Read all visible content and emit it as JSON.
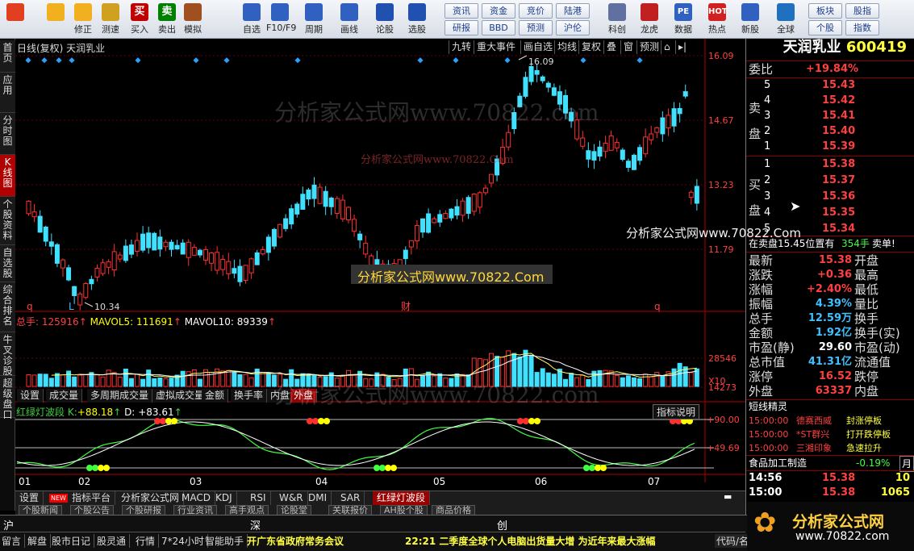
{
  "toolbar": {
    "buttons": [
      {
        "label": "",
        "icon": "windows-logo-icon",
        "color": "#e04020"
      },
      {
        "label": "",
        "icon": "back-arrow-icon",
        "color": "#f0b020"
      },
      {
        "label": "修正",
        "icon": "up-arrow-icon",
        "color": "#f0b020"
      },
      {
        "label": "测速",
        "icon": "clock-icon",
        "color": "#d0a020"
      },
      {
        "label": "买入",
        "icon": "buy-icon",
        "color": "#c00000",
        "glyph": "买"
      },
      {
        "label": "卖出",
        "icon": "sell-icon",
        "color": "#008000",
        "glyph": "卖"
      },
      {
        "label": "模拟",
        "icon": "hammer-icon",
        "color": "#a05020"
      },
      {
        "label": "自选",
        "icon": "star-icon",
        "color": "#3060c0"
      },
      {
        "label": "F10/F9",
        "icon": "f10-icon",
        "color": "#3060c0"
      },
      {
        "label": "周期",
        "icon": "period-icon",
        "color": "#3060c0"
      },
      {
        "label": "画线",
        "icon": "pencil-icon",
        "color": "#3060c0"
      },
      {
        "label": "论股",
        "icon": "forum-icon",
        "color": "#2050b0"
      },
      {
        "label": "选股",
        "icon": "select-stock-icon",
        "color": "#2050b0"
      }
    ],
    "small_buttons": [
      "资讯",
      "资金",
      "竞价",
      "陆港",
      "研报",
      "BBD",
      "预测",
      "沪伦"
    ],
    "right_buttons": [
      {
        "label": "科创",
        "icon": "chart-icon",
        "color": "#6070a0"
      },
      {
        "label": "龙虎",
        "icon": "dragon-tiger-icon",
        "color": "#c02020"
      },
      {
        "label": "数据",
        "icon": "pe-data-icon",
        "color": "#3060c0",
        "glyph": "PE"
      },
      {
        "label": "热点",
        "icon": "hot-icon",
        "color": "#d02020",
        "glyph": "HOT"
      },
      {
        "label": "新股",
        "icon": "new-stock-icon",
        "color": "#3060c0"
      },
      {
        "label": "全球",
        "icon": "globe-icon",
        "color": "#2070c0"
      }
    ],
    "far_right": [
      "板块",
      "股指",
      "个股",
      "指数"
    ]
  },
  "left_nav": [
    "首页",
    "应用",
    "分时图",
    "K线图",
    "个股资料",
    "自选股",
    "综合排名",
    "牛叉诊股",
    "超级盘口"
  ],
  "chart": {
    "header": "日线(复权) 天润乳业",
    "menu": [
      "九转",
      "重大事件",
      "画自选",
      "均线",
      "复权",
      "叠",
      "窗",
      "预测"
    ],
    "price_axis": [
      "16.09",
      "14.67",
      "13.23",
      "11.79"
    ],
    "high_label": "16.09",
    "low_label": "10.34",
    "markers": [
      "q",
      "L",
      "财",
      "q"
    ],
    "vol_header": {
      "label": "总手:",
      "value": "125916",
      "ma5_label": "MAVOL5:",
      "ma5": "111691",
      "ma10_label": "MAVOL10:",
      "ma10": "89339"
    },
    "vol_axis": [
      "28546",
      "14273",
      "X10"
    ],
    "vol_tabs": [
      "设置",
      "成交量",
      "多周期成交量",
      "虚拟成交量",
      "金额",
      "换手率",
      "内盘",
      "外盘"
    ],
    "ind_header": {
      "name": "红绿灯波段",
      "k_label": "K:",
      "k": "+88.18",
      "d_label": "D:",
      "d": "+83.61"
    },
    "ind_btn": "指标说明",
    "ind_axis": [
      "+90.00",
      "+49.69"
    ],
    "months": [
      "01",
      "02",
      "03",
      "04",
      "05",
      "06",
      "07"
    ],
    "bottom_tabs": [
      "设置",
      "指标平台",
      "分析家公式网",
      "MACD",
      "KDJ",
      "RSI",
      "W&R",
      "DMI",
      "SAR",
      "红绿灯波段"
    ],
    "new_badge": "NEW",
    "bottom_tabs2": [
      "个股新闻",
      "个股公告",
      "个股研报",
      "行业资讯",
      "高手观点",
      "论股堂",
      "关联报价",
      "AH股个股",
      "商品价格"
    ]
  },
  "quote": {
    "name": "天润乳业",
    "code": "600419",
    "weibi": {
      "label": "委比",
      "value": "+19.84%"
    },
    "sell_label": "卖盘",
    "buy_label": "买盘",
    "asks": [
      {
        "lvl": "5",
        "price": "15.43"
      },
      {
        "lvl": "4",
        "price": "15.42"
      },
      {
        "lvl": "3",
        "price": "15.41"
      },
      {
        "lvl": "2",
        "price": "15.40"
      },
      {
        "lvl": "1",
        "price": "15.39"
      }
    ],
    "bids": [
      {
        "lvl": "1",
        "price": "15.38"
      },
      {
        "lvl": "2",
        "price": "15.37"
      },
      {
        "lvl": "3",
        "price": "15.36"
      },
      {
        "lvl": "4",
        "price": "15.35"
      },
      {
        "lvl": "5",
        "price": "15.34"
      }
    ],
    "notice": {
      "pre": "在卖盘15.45位置有",
      "qty": "354手",
      "post": "卖单!"
    },
    "stats": [
      {
        "l": "最新",
        "v": "15.38",
        "c": "#ff4040",
        "r": "开盘"
      },
      {
        "l": "涨跌",
        "v": "+0.36",
        "c": "#ff4040",
        "r": "最高"
      },
      {
        "l": "涨幅",
        "v": "+2.40%",
        "c": "#ff4040",
        "r": "最低"
      },
      {
        "l": "振幅",
        "v": "4.39%",
        "c": "#40c0ff",
        "r": "量比"
      },
      {
        "l": "总手",
        "v": "12.59万",
        "c": "#40c0ff",
        "r": "换手"
      },
      {
        "l": "金额",
        "v": "1.92亿",
        "c": "#40c0ff",
        "r": "换手(实)"
      },
      {
        "l": "市盈(静)",
        "v": "29.60",
        "c": "#ffffff",
        "r": "市盈(动)"
      },
      {
        "l": "总市值",
        "v": "41.31亿",
        "c": "#40c0ff",
        "r": "流通值"
      },
      {
        "l": "涨停",
        "v": "16.52",
        "c": "#ff4040",
        "r": "跌停"
      },
      {
        "l": "外盘",
        "v": "63337",
        "c": "#ff4040",
        "r": "内盘"
      }
    ],
    "short_title": "短线精灵",
    "short_rows": [
      {
        "t": "15:00:00",
        "a": "德赛西威",
        "b": "封涨停板"
      },
      {
        "t": "15:00:00",
        "a": "*ST群兴",
        "b": "打开跌停板"
      },
      {
        "t": "15:00:00",
        "a": "三湘印象",
        "b": "急速拉升"
      }
    ],
    "sector": {
      "name": "食品加工制造",
      "chg": "-0.19%"
    },
    "ticks": [
      {
        "t": "14:56",
        "p": "15.38",
        "v": "10"
      },
      {
        "t": "15:00",
        "p": "15.38",
        "v": "1065"
      }
    ]
  },
  "status": {
    "markets": [
      "沪",
      "深",
      "创"
    ],
    "items": [
      "留言",
      "解盘",
      "股市日记",
      "股灵通",
      "行情",
      "7*24小时",
      "智能助手"
    ],
    "news1": "开广东省政府常务会议",
    "news2": "22:21 二季度全球个人电脑出货量大增 为近年来最大涨幅",
    "code_label": "代码/名"
  },
  "watermark": {
    "text1": "分析家公式网www.70822.com",
    "text2": "分析家公式网www.70822.Com",
    "logo": "分析家公式网",
    "logo_url": "www.70822.com"
  }
}
